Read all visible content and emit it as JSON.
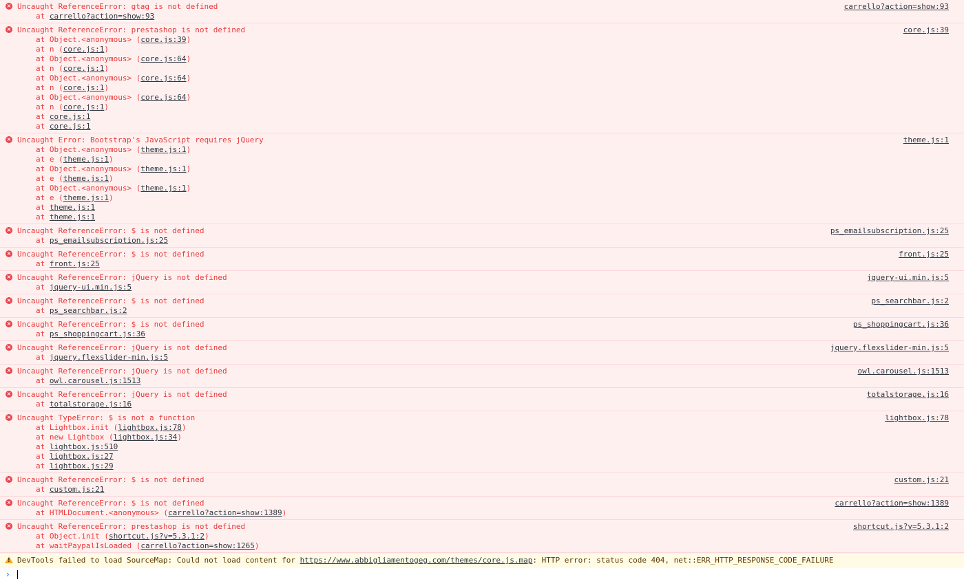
{
  "messages": [
    {
      "level": "error",
      "text": "Uncaught ReferenceError: gtag is not defined",
      "source": "carrello?action=show:93",
      "frames": [
        {
          "pre": "at ",
          "link": "carrello?action=show:93",
          "post": ""
        }
      ]
    },
    {
      "level": "error",
      "text": "Uncaught ReferenceError: prestashop is not defined",
      "source": "core.js:39",
      "frames": [
        {
          "pre": "at Object.<anonymous> (",
          "link": "core.js:39",
          "post": ")"
        },
        {
          "pre": "at n (",
          "link": "core.js:1",
          "post": ")"
        },
        {
          "pre": "at Object.<anonymous> (",
          "link": "core.js:64",
          "post": ")"
        },
        {
          "pre": "at n (",
          "link": "core.js:1",
          "post": ")"
        },
        {
          "pre": "at Object.<anonymous> (",
          "link": "core.js:64",
          "post": ")"
        },
        {
          "pre": "at n (",
          "link": "core.js:1",
          "post": ")"
        },
        {
          "pre": "at Object.<anonymous> (",
          "link": "core.js:64",
          "post": ")"
        },
        {
          "pre": "at n (",
          "link": "core.js:1",
          "post": ")"
        },
        {
          "pre": "at ",
          "link": "core.js:1",
          "post": ""
        },
        {
          "pre": "at ",
          "link": "core.js:1",
          "post": ""
        }
      ]
    },
    {
      "level": "error",
      "text": "Uncaught Error: Bootstrap's JavaScript requires jQuery",
      "source": "theme.js:1",
      "frames": [
        {
          "pre": "at Object.<anonymous> (",
          "link": "theme.js:1",
          "post": ")"
        },
        {
          "pre": "at e (",
          "link": "theme.js:1",
          "post": ")"
        },
        {
          "pre": "at Object.<anonymous> (",
          "link": "theme.js:1",
          "post": ")"
        },
        {
          "pre": "at e (",
          "link": "theme.js:1",
          "post": ")"
        },
        {
          "pre": "at Object.<anonymous> (",
          "link": "theme.js:1",
          "post": ")"
        },
        {
          "pre": "at e (",
          "link": "theme.js:1",
          "post": ")"
        },
        {
          "pre": "at ",
          "link": "theme.js:1",
          "post": ""
        },
        {
          "pre": "at ",
          "link": "theme.js:1",
          "post": ""
        }
      ]
    },
    {
      "level": "error",
      "text": "Uncaught ReferenceError: $ is not defined",
      "source": "ps_emailsubscription.js:25",
      "frames": [
        {
          "pre": "at ",
          "link": "ps_emailsubscription.js:25",
          "post": ""
        }
      ]
    },
    {
      "level": "error",
      "text": "Uncaught ReferenceError: $ is not defined",
      "source": "front.js:25",
      "frames": [
        {
          "pre": "at ",
          "link": "front.js:25",
          "post": ""
        }
      ]
    },
    {
      "level": "error",
      "text": "Uncaught ReferenceError: jQuery is not defined",
      "source": "jquery-ui.min.js:5",
      "frames": [
        {
          "pre": "at ",
          "link": "jquery-ui.min.js:5",
          "post": ""
        }
      ]
    },
    {
      "level": "error",
      "text": "Uncaught ReferenceError: $ is not defined",
      "source": "ps_searchbar.js:2",
      "frames": [
        {
          "pre": "at ",
          "link": "ps_searchbar.js:2",
          "post": ""
        }
      ]
    },
    {
      "level": "error",
      "text": "Uncaught ReferenceError: $ is not defined",
      "source": "ps_shoppingcart.js:36",
      "frames": [
        {
          "pre": "at ",
          "link": "ps_shoppingcart.js:36",
          "post": ""
        }
      ]
    },
    {
      "level": "error",
      "text": "Uncaught ReferenceError: jQuery is not defined",
      "source": "jquery.flexslider-min.js:5",
      "frames": [
        {
          "pre": "at ",
          "link": "jquery.flexslider-min.js:5",
          "post": ""
        }
      ]
    },
    {
      "level": "error",
      "text": "Uncaught ReferenceError: jQuery is not defined",
      "source": "owl.carousel.js:1513",
      "frames": [
        {
          "pre": "at ",
          "link": "owl.carousel.js:1513",
          "post": ""
        }
      ]
    },
    {
      "level": "error",
      "text": "Uncaught ReferenceError: jQuery is not defined",
      "source": "totalstorage.js:16",
      "frames": [
        {
          "pre": "at ",
          "link": "totalstorage.js:16",
          "post": ""
        }
      ]
    },
    {
      "level": "error",
      "text": "Uncaught TypeError: $ is not a function",
      "source": "lightbox.js:78",
      "frames": [
        {
          "pre": "at Lightbox.init (",
          "link": "lightbox.js:78",
          "post": ")"
        },
        {
          "pre": "at new Lightbox (",
          "link": "lightbox.js:34",
          "post": ")"
        },
        {
          "pre": "at ",
          "link": "lightbox.js:510",
          "post": ""
        },
        {
          "pre": "at ",
          "link": "lightbox.js:27",
          "post": ""
        },
        {
          "pre": "at ",
          "link": "lightbox.js:29",
          "post": ""
        }
      ]
    },
    {
      "level": "error",
      "text": "Uncaught ReferenceError: $ is not defined",
      "source": "custom.js:21",
      "frames": [
        {
          "pre": "at ",
          "link": "custom.js:21",
          "post": ""
        }
      ]
    },
    {
      "level": "error",
      "text": "Uncaught ReferenceError: $ is not defined",
      "source": "carrello?action=show:1389",
      "frames": [
        {
          "pre": "at HTMLDocument.<anonymous> (",
          "link": "carrello?action=show:1389",
          "post": ")"
        }
      ]
    },
    {
      "level": "error",
      "text": "Uncaught ReferenceError: prestashop is not defined",
      "source": "shortcut.js?v=5.3.1:2",
      "frames": [
        {
          "pre": "at Object.init (",
          "link": "shortcut.js?v=5.3.1:2",
          "post": ")"
        },
        {
          "pre": "at waitPaypalIsLoaded (",
          "link": "carrello?action=show:1265",
          "post": ")"
        }
      ]
    }
  ],
  "warning": {
    "pre": "DevTools failed to load SourceMap: Could not load content for ",
    "link": "https://www.abbigliamentogeg.com/themes/core.js.map",
    "post": ": HTTP error: status code 404, net::ERR_HTTP_RESPONSE_CODE_FAILURE"
  },
  "icons": {
    "error": "error-circle-icon",
    "warning": "warning-triangle-icon",
    "prompt": "prompt-chevron-icon"
  },
  "colors": {
    "error_bg": "#fff0f0",
    "error_text": "#e83a3a",
    "warning_bg": "#fffbe5",
    "link_text": "#303942",
    "prompt_chevron": "#1a73e8"
  }
}
